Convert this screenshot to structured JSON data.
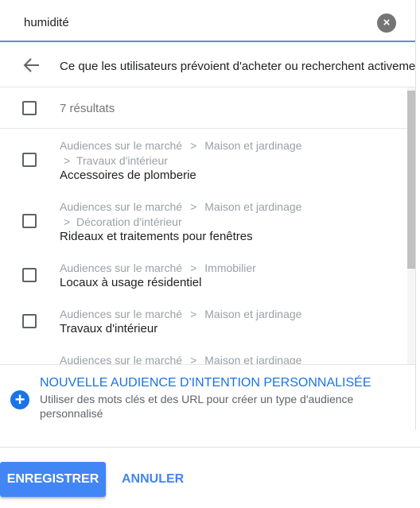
{
  "search": {
    "value": "humidité"
  },
  "header": {
    "title": "Ce que les utilisateurs prévoient d'acheter ou recherchent activement"
  },
  "results": {
    "count_label": "7 résultats"
  },
  "items": [
    {
      "path1": "Audiences sur le marché",
      "sep1": ">",
      "path2": "Maison et jardinage",
      "sep2": ">",
      "path3": "Travaux d'intérieur",
      "name": "Accessoires de plomberie"
    },
    {
      "path1": "Audiences sur le marché",
      "sep1": ">",
      "path2": "Maison et jardinage",
      "sep2": ">",
      "path3": "Décoration d'intérieur",
      "name": "Rideaux et traitements pour fenêtres"
    },
    {
      "path1": "Audiences sur le marché",
      "sep1": ">",
      "path2": "Immobilier",
      "name": "Locaux à usage résidentiel"
    },
    {
      "path1": "Audiences sur le marché",
      "sep1": ">",
      "path2": "Maison et jardinage",
      "name": "Travaux d'intérieur"
    },
    {
      "path1": "Audiences sur le marché",
      "sep1": ">",
      "path2": "Maison et jardinage"
    }
  ],
  "new_audience": {
    "title": "NOUVELLE AUDIENCE D'INTENTION PERSONNALISÉE",
    "description": "Utiliser des mots clés et des URL pour créer un type d'audience personnalisé"
  },
  "footer": {
    "save_label": "ENREGISTRER",
    "cancel_label": "ANNULER"
  },
  "colors": {
    "accent": "#4285f4",
    "link": "#1a73e8",
    "muted": "#9aa0a6"
  }
}
